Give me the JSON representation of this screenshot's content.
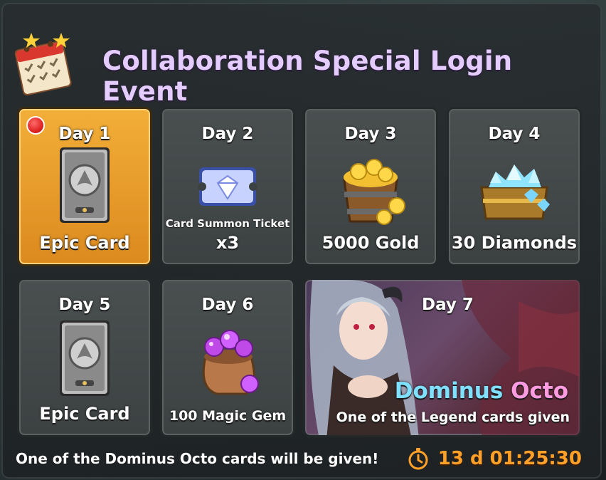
{
  "title": "Collaboration Special Login Event",
  "days": [
    {
      "day": "Day 1",
      "reward": "Epic Card",
      "icon": "epic-card-icon",
      "active": true,
      "notify": true
    },
    {
      "day": "Day 2",
      "reward_sub": "Card Summon Ticket",
      "reward": "x3",
      "icon": "summon-ticket-icon"
    },
    {
      "day": "Day 3",
      "reward": "5000 Gold",
      "icon": "gold-bucket-icon"
    },
    {
      "day": "Day 4",
      "reward": "30 Diamonds",
      "icon": "diamond-chest-icon"
    },
    {
      "day": "Day 5",
      "reward": "Epic Card",
      "icon": "epic-card-icon"
    },
    {
      "day": "Day 6",
      "reward": "100 Magic Gem",
      "icon": "magic-gem-bag-icon"
    },
    {
      "day": "Day 7",
      "reward_name_part1": "Dominus",
      "reward_name_part2": "Octo",
      "reward_desc": "One of the Legend cards given",
      "icon": "dominus-octo-portrait"
    }
  ],
  "footer": {
    "note": "One of the Dominus Octo cards will be given!",
    "timer": "13 d 01:25:30"
  },
  "colors": {
    "title": "#e4ccff",
    "active_card": "#f2ae38",
    "timer": "#ffa028",
    "name_blue": "#7fe0ff",
    "name_pink": "#ff9be0"
  }
}
